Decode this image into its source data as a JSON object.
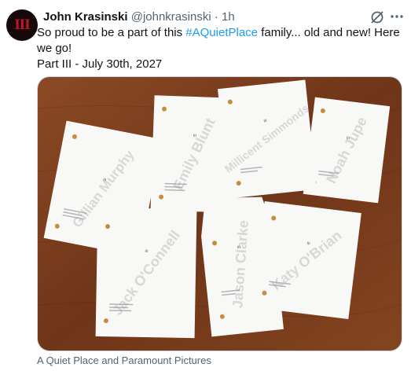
{
  "tweet": {
    "avatar_text": "III",
    "author_name": "John Krasinski",
    "handle": "@johnkrasinski",
    "separator": "·",
    "time": "1h",
    "text_before": "So proud to be a part of this ",
    "hashtag": "#AQuietPlace",
    "text_after": " family... old and new!  Here we go!",
    "line2": "Part III - July 30th, 2027",
    "media_caption": "A Quiet Place and Paramount Pictures"
  },
  "scripts": [
    {
      "watermark": "Gillian Murphy",
      "title": "III"
    },
    {
      "watermark": "Emily Blunt",
      "title": "III"
    },
    {
      "watermark": "Millicent Simmonds",
      "title": "III"
    },
    {
      "watermark": "Noah Jupe",
      "title": "III"
    },
    {
      "watermark": "Jack O'Connell",
      "title": "III"
    },
    {
      "watermark": "Jason Clarke",
      "title": "III"
    },
    {
      "watermark": "Katy O'Brian",
      "title": "III"
    }
  ],
  "icons": {
    "grok": "grok-icon",
    "more": "more-icon"
  },
  "colors": {
    "link": "#1d9bf0",
    "muted": "#536471",
    "text": "#0f1419",
    "table": "#7a3f1f",
    "avatar_mark": "#c8142a"
  }
}
